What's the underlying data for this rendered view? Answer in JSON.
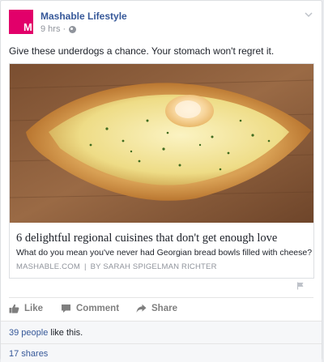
{
  "post": {
    "page_name": "Mashable Lifestyle",
    "avatar_letter": "M",
    "timestamp": "9 hrs",
    "meta_separator": "·",
    "text": "Give these underdogs a chance. Your stomach won't regret it.",
    "brand_color": "#e2006a"
  },
  "link": {
    "title": "6 delightful regional cuisines that don't get enough love",
    "description": "What do you mean you've never had Georgian bread bowls filled with cheese?",
    "domain": "MASHABLE.COM",
    "separator": "|",
    "byline": "BY SARAH SPIGELMAN RICHTER"
  },
  "actions": {
    "like_label": "Like",
    "comment_label": "Comment",
    "share_label": "Share"
  },
  "reactions": {
    "people_count": "39 people",
    "people_suffix": " like this.",
    "shares": "17 shares"
  },
  "icons": {
    "options": "chevron-down-icon",
    "privacy": "globe-icon",
    "report": "flag-icon",
    "like": "thumbs-up-icon",
    "comment": "comment-icon",
    "share": "share-arrow-icon"
  }
}
